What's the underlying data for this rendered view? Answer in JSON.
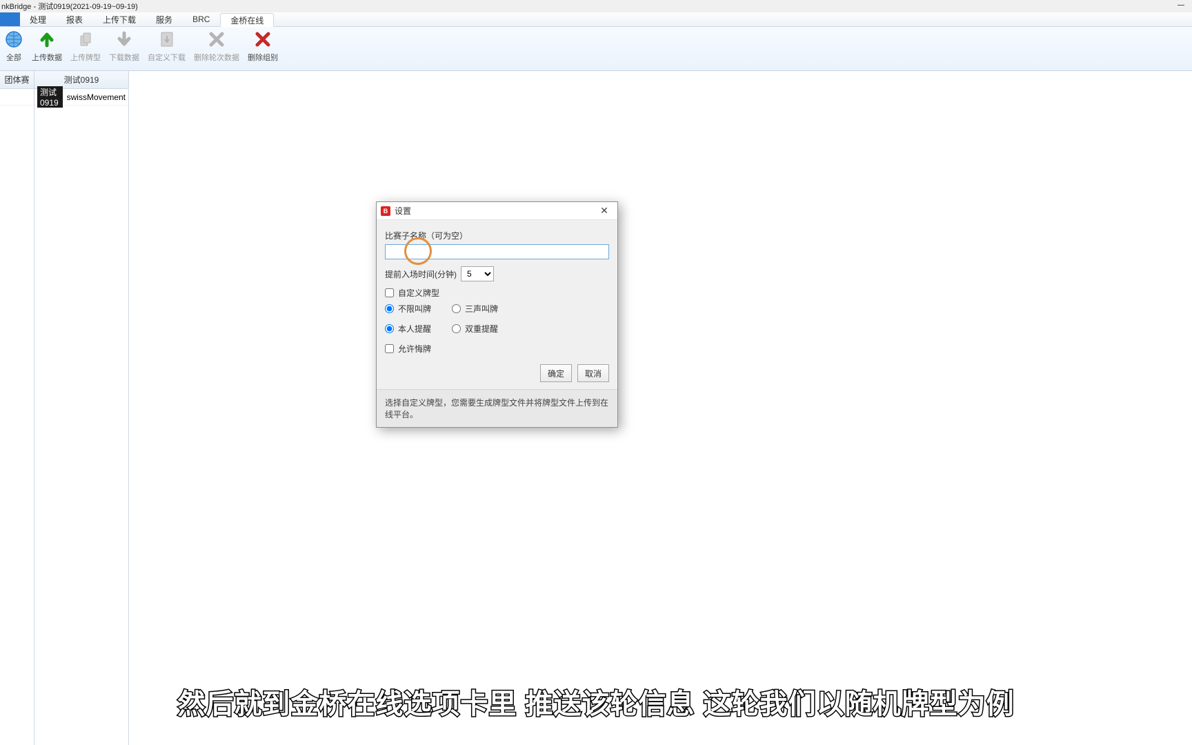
{
  "window": {
    "title": "nkBridge - 测试0919(2021-09-19~09-19)"
  },
  "menu": {
    "items": [
      "处理",
      "报表",
      "上传下载",
      "服务",
      "BRC",
      "金桥在线"
    ],
    "activeIndex": 5
  },
  "ribbon": {
    "buttons": [
      {
        "label": "全部",
        "icon": "globe",
        "disabled": false
      },
      {
        "label": "上传数据",
        "icon": "up",
        "disabled": false
      },
      {
        "label": "上传牌型",
        "icon": "up2",
        "disabled": true
      },
      {
        "label": "下载数据",
        "icon": "down",
        "disabled": true
      },
      {
        "label": "自定义下载",
        "icon": "down2",
        "disabled": true
      },
      {
        "label": "删除轮次数据",
        "icon": "xorange",
        "disabled": true
      },
      {
        "label": "删除组别",
        "icon": "xred",
        "disabled": false
      }
    ]
  },
  "side": {
    "col_a_header": "团体赛",
    "col_b_header": "测试0919",
    "col_a_row": "",
    "col_b_item": "测试0919",
    "col_b_movement": "swissMovement"
  },
  "dialog": {
    "title": "设置",
    "name_label": "比赛子名称（可为空）",
    "name_value": "",
    "time_label": "提前入场时间(分钟)",
    "time_value": "5",
    "chk_custom": "自定义牌型",
    "rad_bid_a": "不限叫牌",
    "rad_bid_b": "三声叫牌",
    "rad_rem_a": "本人提醒",
    "rad_rem_b": "双重提醒",
    "chk_undo": "允许悔牌",
    "ok": "确定",
    "cancel": "取消",
    "foot": "选择自定义牌型，您需要生成牌型文件并将牌型文件上传到在线平台。"
  },
  "subtitle": "然后就到金桥在线选项卡里 推送该轮信息 这轮我们以随机牌型为例"
}
